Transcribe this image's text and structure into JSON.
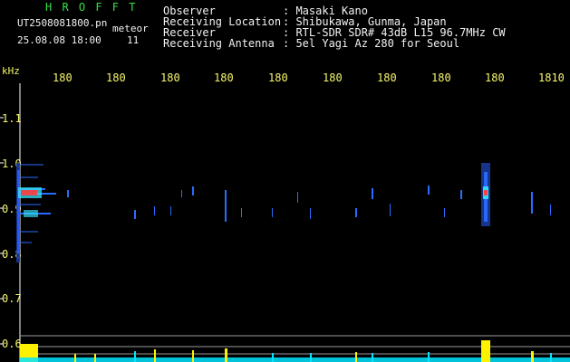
{
  "app": {
    "name": "H R O F F T",
    "filename": "UT2508081800.pn",
    "tag": "meteor",
    "datetime": "25.08.08 18:00",
    "count": "11"
  },
  "info": {
    "labels": [
      "Observer",
      "Receiving Location",
      "Receiver",
      "Receiving Antenna"
    ],
    "values": [
      ": Masaki Kano",
      ": Shibukawa, Gunma, Japan",
      ": RTL-SDR SDR# 43dB L15 96.7MHz CW",
      ": 5el Yagi Az 280 for Seoul"
    ]
  },
  "axis": {
    "unit": "kHz",
    "x_ticks": [
      "180",
      "180",
      "180",
      "180",
      "180",
      "180",
      "180",
      "180",
      "180",
      "1810"
    ],
    "y_ticks": [
      "1.1",
      "1.0",
      "0.9",
      "0.8",
      "0.7",
      "0.6"
    ]
  },
  "colors": {
    "title": "#36e04a",
    "text": "#f6f66a",
    "hline": "#9a9a9a",
    "echo_blue": "#2a6cff",
    "echo_cyan": "#33e7ff",
    "echo_red": "#ff3b3b",
    "bar_yellow": "#fff200",
    "bar_cyan": "#00e5ff"
  }
}
